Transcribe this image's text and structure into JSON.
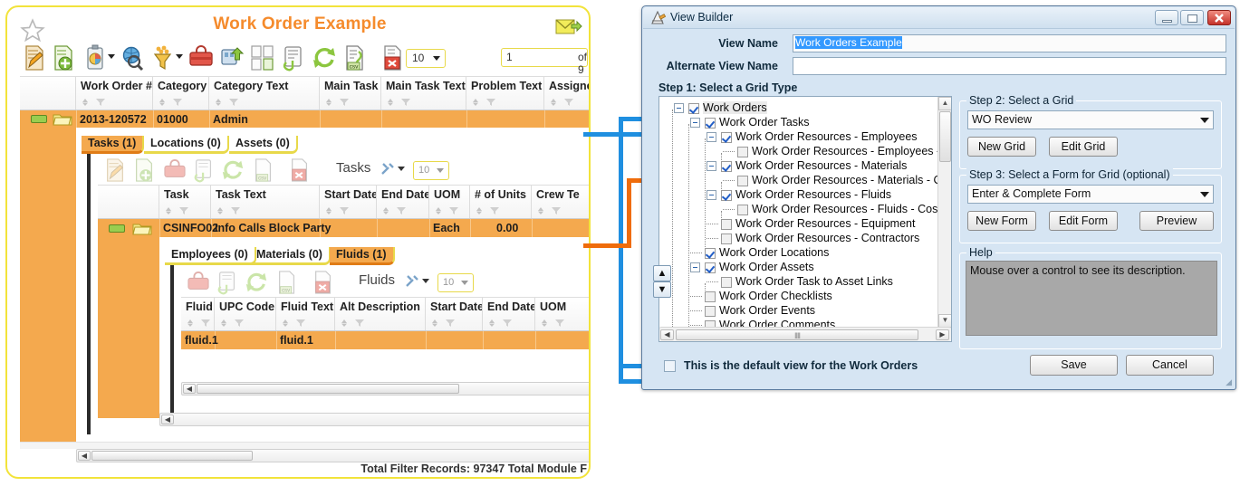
{
  "left_panel": {
    "title": "Work Order Example",
    "icons": {
      "favorite": "star-icon",
      "email": "email-export-icon"
    },
    "toolbar": {
      "buttons": [
        {
          "name": "edit-record-icon",
          "label": "Edit"
        },
        {
          "name": "add-record-icon",
          "label": "Add"
        },
        {
          "name": "report-icon",
          "label": "Reports"
        },
        {
          "name": "search-icon",
          "label": "Search"
        },
        {
          "name": "filter-icon",
          "label": "Filter"
        },
        {
          "name": "toolbox-icon",
          "label": "Tools"
        },
        {
          "name": "export-icon",
          "label": "Export"
        },
        {
          "name": "copy-icon",
          "label": "Copy"
        },
        {
          "name": "attachment-icon",
          "label": "Attachments"
        },
        {
          "name": "refresh-icon",
          "label": "Refresh"
        },
        {
          "name": "csv-icon",
          "label": "CSV"
        },
        {
          "name": "delete-icon",
          "label": "Delete"
        }
      ],
      "page_size": "10",
      "page_number": "1",
      "page_of": "of 9"
    },
    "grid": {
      "columns": [
        "Work Order #",
        "Category",
        "Category Text",
        "Main Task",
        "Main Task Text",
        "Problem Text",
        "Assigned Cr"
      ],
      "rows": [
        {
          "work_order": "2013-120572",
          "category": "01000",
          "category_text": "Admin",
          "main_task": "",
          "main_task_text": "",
          "problem_text": "",
          "assigned_crew": ""
        }
      ]
    },
    "level1_tabs": [
      {
        "label": "Tasks (1)",
        "active": true
      },
      {
        "label": "Locations (0)",
        "active": false
      },
      {
        "label": "Assets (0)",
        "active": false
      }
    ],
    "tasks_grid": {
      "title": "Tasks",
      "page_size": "10",
      "toolbar_icons": [
        "edit-record-icon",
        "add-record-icon",
        "toolbox-icon",
        "attachment-icon",
        "refresh-icon",
        "csv-icon",
        "delete-icon"
      ],
      "columns": [
        "Task",
        "Task Text",
        "Start Date",
        "End Date",
        "UOM",
        "# of Units",
        "Crew Te"
      ],
      "rows": [
        {
          "task": "CSINFO02",
          "task_text": "Info Calls Block Party",
          "start_date": "",
          "end_date": "",
          "uom": "Each",
          "units": "0.00",
          "crew": ""
        }
      ]
    },
    "level2_tabs": [
      {
        "label": "Employees (0)",
        "active": false
      },
      {
        "label": "Materials (0)",
        "active": false
      },
      {
        "label": "Fluids (1)",
        "active": true
      }
    ],
    "fluids_grid": {
      "title": "Fluids",
      "page_size": "10",
      "toolbar_icons": [
        "toolbox-icon",
        "attachment-icon",
        "refresh-icon",
        "csv-icon",
        "delete-icon"
      ],
      "columns": [
        "Fluid",
        "UPC Code",
        "Fluid Text",
        "Alt Description",
        "Start Date",
        "End Date",
        "UOM"
      ],
      "rows": [
        {
          "fluid": "fluid.1",
          "upc_code": "",
          "fluid_text": "fluid.1",
          "alt_description": "",
          "start_date": "",
          "end_date": "",
          "uom": ""
        }
      ]
    },
    "status_bar": "Total Filter Records: 97347  Total Module F"
  },
  "view_builder": {
    "window_title": "View Builder",
    "window_icon": "view-builder-icon",
    "title_buttons": [
      "minimize",
      "maximize",
      "close"
    ],
    "view_name_label": "View Name",
    "view_name_value": "Work Orders Example",
    "alt_view_name_label": "Alternate View Name",
    "alt_view_name_value": "",
    "step1": {
      "caption": "Step 1: Select a Grid Type",
      "tree": [
        {
          "label": "Work Orders",
          "indent": 0,
          "checked": true,
          "expander": "minus"
        },
        {
          "label": "Work Order Tasks",
          "indent": 1,
          "checked": true,
          "expander": "minus"
        },
        {
          "label": "Work Order Resources - Employees",
          "indent": 2,
          "checked": true,
          "expander": "minus"
        },
        {
          "label": "Work Order Resources - Employees - Cost M",
          "indent": 3,
          "checked": false,
          "expander": "none"
        },
        {
          "label": "Work Order Resources - Materials",
          "indent": 2,
          "checked": true,
          "expander": "minus"
        },
        {
          "label": "Work Order Resources - Materials - Cost Ma",
          "indent": 3,
          "checked": false,
          "expander": "none"
        },
        {
          "label": "Work Order Resources - Fluids",
          "indent": 2,
          "checked": true,
          "expander": "minus"
        },
        {
          "label": "Work Order Resources - Fluids - Cost Marku",
          "indent": 3,
          "checked": false,
          "expander": "none"
        },
        {
          "label": "Work Order Resources - Equipment",
          "indent": 2,
          "checked": false,
          "expander": "none"
        },
        {
          "label": "Work Order Resources - Contractors",
          "indent": 2,
          "checked": false,
          "expander": "none"
        },
        {
          "label": "Work Order Locations",
          "indent": 1,
          "checked": true,
          "expander": "none"
        },
        {
          "label": "Work Order Assets",
          "indent": 1,
          "checked": true,
          "expander": "minus"
        },
        {
          "label": "Work Order Task to Asset Links",
          "indent": 2,
          "checked": false,
          "expander": "none"
        },
        {
          "label": "Work Order Checklists",
          "indent": 1,
          "checked": false,
          "expander": "none"
        },
        {
          "label": "Work Order Events",
          "indent": 1,
          "checked": false,
          "expander": "none"
        },
        {
          "label": "Work Order Comments",
          "indent": 1,
          "checked": false,
          "expander": "none"
        }
      ],
      "move_up": "▲",
      "move_down": "▼"
    },
    "step2": {
      "caption": "Step 2: Select a Grid",
      "selected_grid": "WO Review",
      "new_button": "New Grid",
      "edit_button": "Edit Grid"
    },
    "step3": {
      "caption": "Step 3: Select a Form for Grid (optional)",
      "selected_form": "Enter & Complete Form",
      "new_button": "New Form",
      "edit_button": "Edit Form",
      "preview_button": "Preview"
    },
    "help": {
      "caption": "Help",
      "text": "Mouse over a control to see its description."
    },
    "default_view_checkbox": {
      "label": "This is the default view for the Work Orders",
      "checked": false
    },
    "save_button": "Save",
    "cancel_button": "Cancel"
  },
  "colors": {
    "accent_orange": "#f58b2c",
    "row_orange": "#f4a94e",
    "card_border_yellow": "#f2e33a",
    "connector_blue": "#1f8fe0",
    "connector_orange": "#ef6c0b",
    "dialog_bg": "#d6e5f3"
  }
}
